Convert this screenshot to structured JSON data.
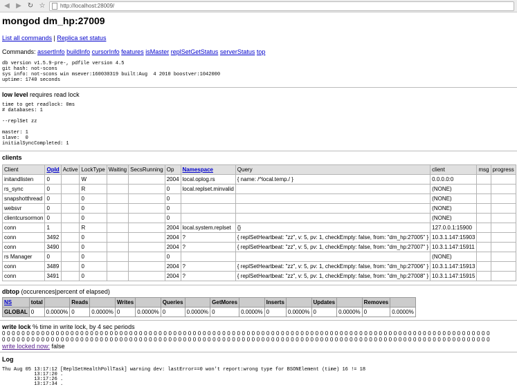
{
  "browser": {
    "url": "http://localhost:28009/"
  },
  "header": {
    "title": "mongod dm_hp:27009"
  },
  "links": {
    "list_all": "List all commands",
    "sep": "|",
    "replica": "Replica set status"
  },
  "commands": {
    "label": "Commands:",
    "items": [
      "assertInfo",
      "buildInfo",
      "cursorInfo",
      "features",
      "isMaster",
      "replSetGetStatus",
      "serverStatus",
      "top"
    ]
  },
  "version_info": "db version v1.5.9-pre-, pdfile version 4.5\ngit hash: not-scons\nsys info: not-scons win msever:160030319 built:Aug  4 2010 boostver:1042000\nuptime: 1740 seconds",
  "low_level": {
    "title": "low level",
    "subtitle": " requires read lock",
    "info": "time to get readlock: 0ms\n# databases: 1\n\n--replSet zz\n\nmaster: 1\nslave:  0\ninitialSyncCompleted: 1"
  },
  "clients": {
    "title": "clients",
    "headers": [
      "Client",
      "OpId",
      "Active",
      "LockType",
      "Waiting",
      "SecsRunning",
      "Op",
      "Namespace",
      "Query",
      "client",
      "msg",
      "progress"
    ],
    "rows": [
      [
        "initandlisten",
        "0",
        "",
        "W",
        "",
        "",
        "2004",
        "local.oplog.rs",
        "{ name: /^local.temp./ }",
        "0.0.0.0:0",
        "",
        ""
      ],
      [
        "rs_sync",
        "0",
        "",
        "R",
        "",
        "",
        "0",
        "local.replset.minvalid",
        "",
        "(NONE)",
        "",
        ""
      ],
      [
        "snapshotthread",
        "0",
        "",
        "0",
        "",
        "",
        "0",
        "",
        "",
        "(NONE)",
        "",
        ""
      ],
      [
        "websvr",
        "0",
        "",
        "0",
        "",
        "",
        "0",
        "",
        "",
        "(NONE)",
        "",
        ""
      ],
      [
        "clientcursormon",
        "0",
        "",
        "0",
        "",
        "",
        "0",
        "",
        "",
        "(NONE)",
        "",
        ""
      ],
      [
        "conn",
        "1",
        "",
        "R",
        "",
        "",
        "2004",
        "local.system.replset",
        "{}",
        "127.0.0.1:15900",
        "",
        ""
      ],
      [
        "conn",
        "3492",
        "",
        "0",
        "",
        "",
        "2004",
        "?",
        "{ replSetHeartbeat: \"zz\", v: 5, pv: 1, checkEmpty: false, from: \"dm_hp:27005\" }",
        "10.3.1.147:15903",
        "",
        ""
      ],
      [
        "conn",
        "3490",
        "",
        "0",
        "",
        "",
        "2004",
        "?",
        "{ replSetHeartbeat: \"zz\", v: 5, pv: 1, checkEmpty: false, from: \"dm_hp:27007\" }",
        "10.3.1.147:15911",
        "",
        ""
      ],
      [
        "rs Manager",
        "0",
        "",
        "0",
        "",
        "",
        "0",
        "",
        "",
        "(NONE)",
        "",
        ""
      ],
      [
        "conn",
        "3489",
        "",
        "0",
        "",
        "",
        "2004",
        "?",
        "{ replSetHeartbeat: \"zz\", v: 5, pv: 1, checkEmpty: false, from: \"dm_hp:27006\" }",
        "10.3.1.147:15913",
        "",
        ""
      ],
      [
        "conn",
        "3491",
        "",
        "0",
        "",
        "",
        "2004",
        "?",
        "{ replSetHeartbeat: \"zz\", v: 5, pv: 1, checkEmpty: false, from: \"dm_hp:27008\" }",
        "10.3.1.147:15915",
        "",
        ""
      ]
    ]
  },
  "dbtop": {
    "title": "dbtop",
    "subtitle": " (occurences|percent of elapsed)",
    "headers": [
      "NS",
      "total",
      "",
      "Reads",
      "",
      "Writes",
      "",
      "Queries",
      "",
      "GetMores",
      "",
      "Inserts",
      "",
      "Updates",
      "",
      "Removes",
      ""
    ],
    "row": [
      "GLOBAL",
      "0",
      "0.0000%",
      "0",
      "0.0000%",
      "0",
      "0.0000%",
      "0",
      "0.0000%",
      "0",
      "0.0000%",
      "0",
      "0.0000%",
      "0",
      "0.0000%",
      "0",
      "0.0000%"
    ]
  },
  "write_lock": {
    "title": "write lock",
    "subtitle": " % time in write lock, by 4 sec periods",
    "zeros_line1": "0 0 0 0 0 0 0 0 0 0 0 0 0 0 0 0 0 0 0 0 0 0 0 0 0 0 0 0 0 0 0 0 0 0 0 0 0 0 0 0 0 0 0 0 0 0 0 0 0 0 0 0 0 0 0 0 0 0 0 0 0 0 0 0 0 0 0 0 0 0 0 0 0 0 0 0 0 0 0 0 0 0 0 0 0 0 0 0 0 0 0 0 0 0 0 0 0 0 0 0",
    "zeros_line2": "0 0 0 0 0 0 0 0 0 0 0 0 0 0 0 0 0 0 0 0 0 0 0 0 0 0 0 0 0 0 0 0 0 0 0 0 0 0 0 0 0 0 0 0 0 0 0 0 0 0 0 0 0 0 0 0 0 0 0 0 0 0 0 0 0 0 0 0 0 0 0 0 0 0 0 0 0 0 0 0 0 0 0 0 0 0 0 0 0 0 0 0 0 0 0 0 0 0 0 0",
    "link": "write locked now:",
    "value": " false"
  },
  "log": {
    "title": "Log",
    "text": "Thu Aug 05 13:17:12 [ReplSetHealthPollTask] warning dev: lastError==0 won't report:wrong type for BSONElement (time) 16 != 18\n           13:17:20 .\n           13:17:26 .\n           13:17:34 ."
  }
}
